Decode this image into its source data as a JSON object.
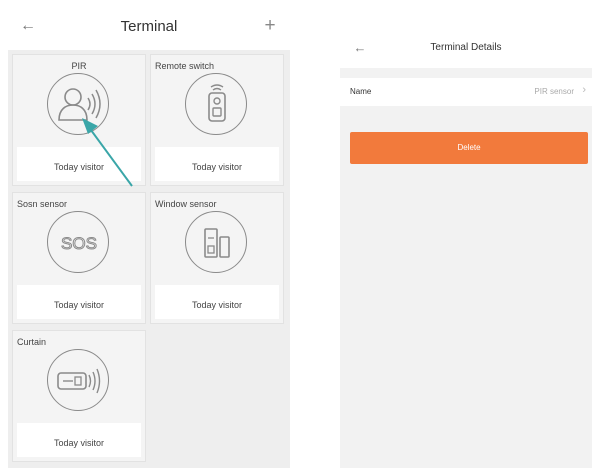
{
  "terminal": {
    "title": "Terminal",
    "back_icon": "arrow-left-icon",
    "add_icon": "plus-icon",
    "devices": [
      {
        "name": "PIR",
        "icon": "pir-motion-icon",
        "footer": "Today visitor"
      },
      {
        "name": "Remote switch",
        "icon": "remote-switch-icon",
        "footer": "Today visitor"
      },
      {
        "name": "Sosn sensor",
        "icon": "sos-icon",
        "footer": "Today visitor"
      },
      {
        "name": "Window sensor",
        "icon": "window-sensor-icon",
        "footer": "Today visitor"
      },
      {
        "name": "Curtain",
        "icon": "curtain-icon",
        "footer": "Today visitor"
      }
    ]
  },
  "details": {
    "title": "Terminal Details",
    "back_icon": "arrow-left-icon",
    "name_label": "Name",
    "name_value": "PIR sensor",
    "chevron_icon": "chevron-right-icon",
    "delete_label": "Delete"
  },
  "colors": {
    "accent": "#f27a3c",
    "arrow": "#3aa6a8",
    "tile_bg": "#f4f4f4",
    "grid_bg": "#eeeeee"
  }
}
